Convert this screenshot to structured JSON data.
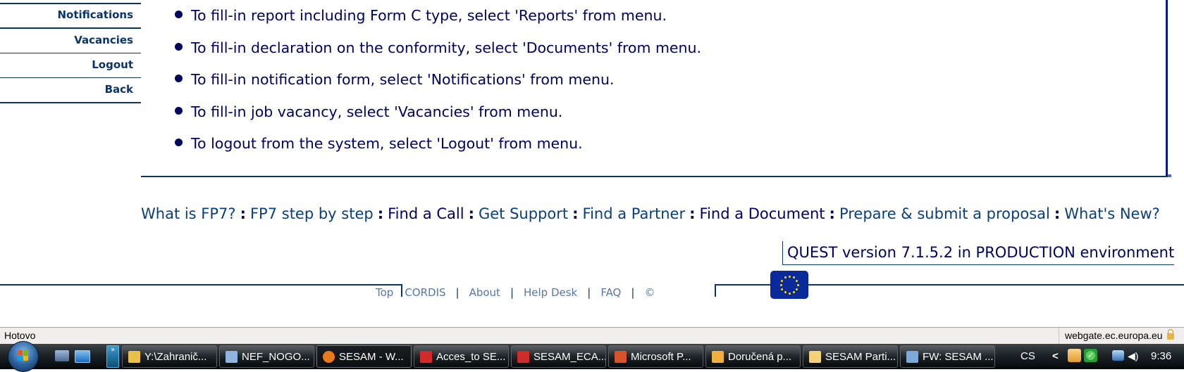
{
  "sidebar": {
    "items": [
      {
        "label": "Notifications"
      },
      {
        "label": "Vacancies"
      },
      {
        "label": "Logout"
      },
      {
        "label": "Back"
      }
    ]
  },
  "instructions": [
    "To fill-in report including Form C type, select 'Reports' from menu.",
    "To fill-in declaration on the conformity, select 'Documents' from menu.",
    "To fill-in notification form, select 'Notifications' from menu.",
    "To fill-in job vacancy, select 'Vacancies' from menu.",
    "To logout from the system, select 'Logout' from menu."
  ],
  "nav_links": {
    "separator": ":",
    "items": [
      {
        "label": "What is FP7?"
      },
      {
        "label": "FP7 step by step"
      },
      {
        "label": "Find a Call"
      },
      {
        "label": "Get Support"
      },
      {
        "label": "Find a Partner"
      },
      {
        "label": "Find a Document"
      },
      {
        "label": "Prepare & submit a proposal"
      },
      {
        "label": "What's New?"
      }
    ]
  },
  "version_text": "QUEST version 7.1.5.2 in PRODUCTION environment",
  "footer": {
    "separator": "|",
    "links": [
      {
        "label": "Top"
      },
      {
        "label": "CORDIS"
      },
      {
        "label": "About"
      },
      {
        "label": "Help Desk"
      },
      {
        "label": "FAQ"
      },
      {
        "label": "©"
      }
    ],
    "logo": "eu-flag"
  },
  "statusbar": {
    "status": "Hotovo",
    "domain": "webgate.ec.europa.eu",
    "secure_icon": "lock-icon"
  },
  "taskbar": {
    "quicklaunch_more": "»",
    "buttons": [
      {
        "label": "Y:\\Zahranič...",
        "icon": "folder-icon",
        "color": "#e8c04a",
        "active": false
      },
      {
        "label": "NEF_NOGO...",
        "icon": "document-icon",
        "color": "#8fb4e0",
        "active": false
      },
      {
        "label": "SESAM - W...",
        "icon": "firefox-icon",
        "color": "#e87a1e",
        "active": true
      },
      {
        "label": "Acces_to SE...",
        "icon": "pdf-icon",
        "color": "#d22b2b",
        "active": false
      },
      {
        "label": "SESAM_ECA...",
        "icon": "pdf-icon",
        "color": "#d22b2b",
        "active": false
      },
      {
        "label": "Microsoft P...",
        "icon": "powerpoint-icon",
        "color": "#d9532c",
        "active": false
      },
      {
        "label": "Doručená p...",
        "icon": "outlook-inbox-icon",
        "color": "#f0b040",
        "active": false
      },
      {
        "label": "SESAM Parti...",
        "icon": "mail-icon",
        "color": "#f3d27a",
        "active": false
      },
      {
        "label": "FW: SESAM ...",
        "icon": "mail-forward-icon",
        "color": "#7ea8d8",
        "active": false
      }
    ],
    "tray": {
      "language": "CS",
      "expand": "<",
      "clock": "9:36"
    }
  }
}
